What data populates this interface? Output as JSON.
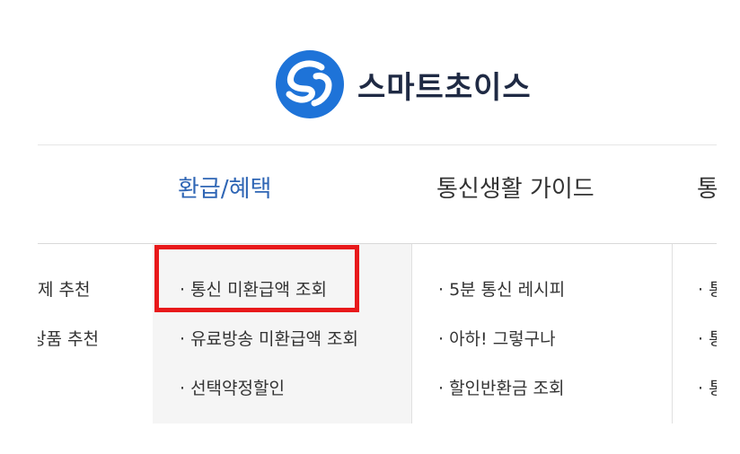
{
  "brand": {
    "name": "스마트초이스",
    "accent": "#1e73d8"
  },
  "nav": {
    "tabs": [
      {
        "label": "환급/혜택",
        "active": true
      },
      {
        "label": "통신생활 가이드",
        "active": false
      },
      {
        "label": "통",
        "active": false
      }
    ]
  },
  "menus": {
    "col0": [
      "제 추천",
      "상품 추천"
    ],
    "col1": [
      "· 통신 미환급액 조회",
      "· 유료방송 미환급액 조회",
      "· 선택약정할인"
    ],
    "col2": [
      "· 5분 통신 레시피",
      "· 아하! 그렇구나",
      "· 할인반환금 조회"
    ],
    "col3": [
      "· 통",
      "· 통",
      "· 통"
    ]
  },
  "colors": {
    "active_tab": "#2f66b5",
    "highlight_box": "#e8191b",
    "panel_bg": "#f5f5f5"
  }
}
